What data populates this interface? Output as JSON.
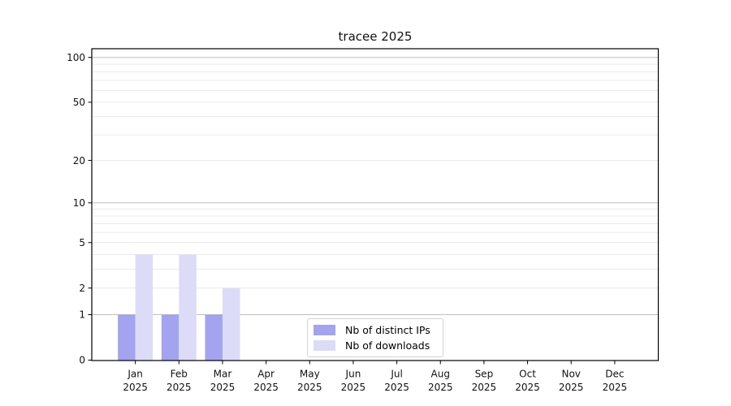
{
  "figure": {
    "background": "#ffffff"
  },
  "chart_data": {
    "type": "bar",
    "title": "tracee 2025",
    "months": [
      "Jan",
      "Feb",
      "Mar",
      "Apr",
      "May",
      "Jun",
      "Jul",
      "Aug",
      "Sep",
      "Oct",
      "Nov",
      "Dec"
    ],
    "year": "2025",
    "series": [
      {
        "name": "Nb of distinct IPs",
        "color": "#a3a3f0",
        "values": [
          1,
          1,
          1,
          0,
          0,
          0,
          0,
          0,
          0,
          0,
          0,
          0
        ]
      },
      {
        "name": "Nb of downloads",
        "color": "#dcdcf8",
        "values": [
          4,
          4,
          2,
          0,
          0,
          0,
          0,
          0,
          0,
          0,
          0,
          0
        ]
      }
    ],
    "yscale": "log1p",
    "ylim": [
      0,
      112
    ],
    "yticks": [
      0,
      1,
      2,
      5,
      10,
      20,
      50,
      100
    ],
    "major_gridlines": [
      1,
      10,
      100
    ],
    "minor_gridlines": [
      2,
      3,
      4,
      5,
      6,
      7,
      8,
      9,
      20,
      30,
      40,
      50,
      60,
      70,
      80,
      90
    ],
    "legend_position": "lower center",
    "grid": true
  }
}
